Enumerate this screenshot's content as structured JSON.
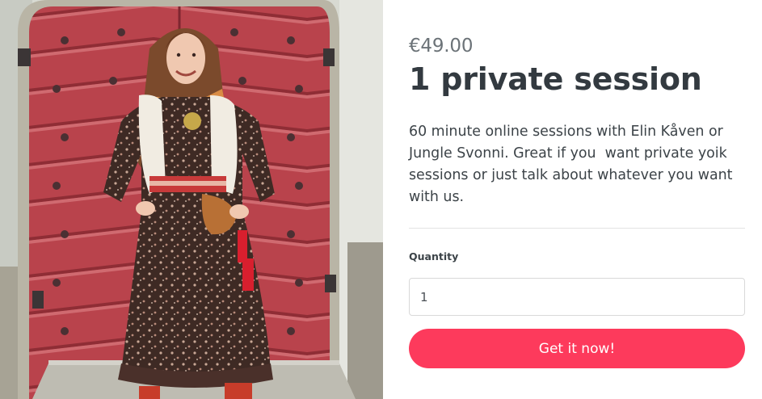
{
  "product": {
    "price": "€49.00",
    "title": "1 private session",
    "description": "60 minute online sessions with Elin Kåven or\nJungle Svonni. Great if you  want private yoik\nsessions or just talk about whatever you want\nwith us.",
    "quantity_label": "Quantity",
    "quantity_value": "1",
    "buy_label": "Get it now!"
  },
  "colors": {
    "accent": "#fd3a5c",
    "heading": "#333a40",
    "price": "#6c7378"
  }
}
